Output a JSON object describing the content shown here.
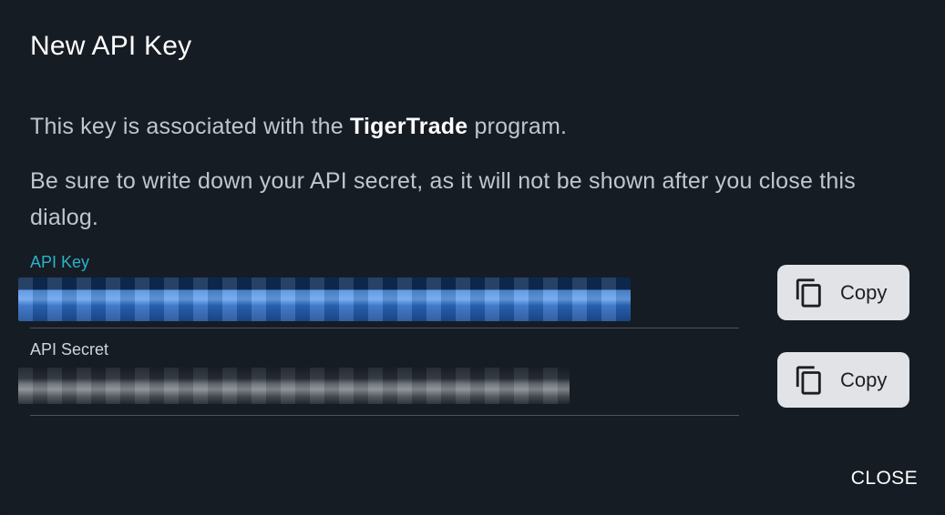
{
  "dialog": {
    "title": "New API Key",
    "paragraph1_prefix": "This key is associated with the ",
    "program_name": "TigerTrade",
    "paragraph1_suffix": " program.",
    "paragraph2": "Be sure to write down your API secret, as it will not be shown after you close this dialog."
  },
  "fields": {
    "api_key": {
      "label": "API Key",
      "value": "",
      "copy_label": "Copy",
      "copy_icon": "copy-icon"
    },
    "api_secret": {
      "label": "API Secret",
      "value": "",
      "copy_label": "Copy",
      "copy_icon": "copy-icon"
    }
  },
  "actions": {
    "close_label": "CLOSE"
  },
  "colors": {
    "background": "#161c24",
    "accent": "#2bb3c9",
    "button_bg": "#e1e3e6"
  }
}
